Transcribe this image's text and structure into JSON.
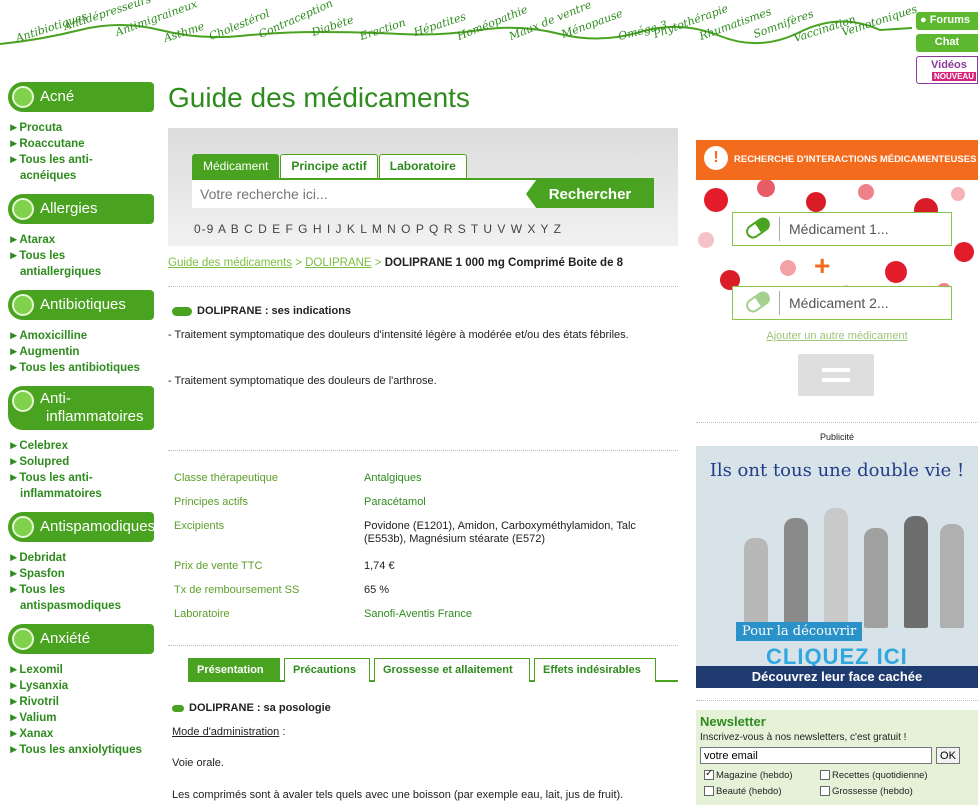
{
  "topnav": {
    "links": [
      "Antibiotiques",
      "Antidépresseurs",
      "Antimigraineux",
      "Asthme",
      "Cholestérol",
      "Contraception",
      "Diabète",
      "Erection",
      "Hépatites",
      "Homéopathie",
      "Maux de ventre",
      "Ménopause",
      "Oméga 3",
      "Phytothérapie",
      "Rhumatismes",
      "Somnifères",
      "Vaccination",
      "Veinotoniques"
    ],
    "forums": "Forums",
    "chat": "Chat",
    "videos": "Vidéos",
    "videos_badge": "NOUVEAU"
  },
  "sidebar": {
    "sections": [
      {
        "title": "Acné",
        "links": [
          "►Procuta",
          "►Roaccutane",
          "►Tous les anti-",
          "acnéiques"
        ]
      },
      {
        "title": "Allergies",
        "links": [
          "►Atarax",
          "►Tous les",
          "antiallergiques"
        ]
      },
      {
        "title": "Antibiotiques",
        "links": [
          "►Amoxicilline",
          "►Augmentin",
          "►Tous les antibiotiques"
        ]
      },
      {
        "title": "Anti-",
        "title2": "inflammatoires",
        "links": [
          "►Celebrex",
          "►Solupred",
          "►Tous les anti-",
          "inflammatoires"
        ]
      },
      {
        "title": "Antispamodiques",
        "links": [
          "►Debridat",
          "►Spasfon",
          "►Tous les",
          "antispasmodiques"
        ]
      },
      {
        "title": "Anxiété",
        "links": [
          "►Lexomil",
          "►Lysanxia",
          "►Rivotril",
          "►Valium",
          "►Xanax",
          "►Tous les anxiolytiques"
        ]
      }
    ]
  },
  "main": {
    "title": "Guide des médicaments",
    "search": {
      "tabs": [
        "Médicament",
        "Principe actif",
        "Laboratoire"
      ],
      "placeholder": "Votre recherche ici...",
      "button": "Rechercher",
      "alphabet": [
        "0-9",
        "A",
        "B",
        "C",
        "D",
        "E",
        "F",
        "G",
        "H",
        "I",
        "J",
        "K",
        "L",
        "M",
        "N",
        "O",
        "P",
        "Q",
        "R",
        "S",
        "T",
        "U",
        "V",
        "W",
        "X",
        "Y",
        "Z"
      ]
    },
    "breadcrumb": {
      "home": "Guide des médicaments",
      "sep": " > ",
      "drug": "DOLIPRANE",
      "current": "DOLIPRANE 1 000 mg Comprimé Boite de 8"
    },
    "indications": {
      "title": "DOLIPRANE : ses indications",
      "p1": "- Traitement symptomatique des douleurs d'intensité légère à modérée et/ou des états fébriles.",
      "p2": "- Traitement symptomatique des douleurs de l'arthrose."
    },
    "info": [
      {
        "label": "Classe thérapeutique",
        "value": "Antalgiques",
        "link": true
      },
      {
        "label": "Principes actifs",
        "value": "Paracétamol",
        "link": true
      },
      {
        "label": "Excipients",
        "value": "Povidone (E1201), Amidon, Carboxyméthylamidon, Talc (E553b), Magnésium stéarate (E572)",
        "link": false
      },
      {
        "label": "Prix de vente TTC",
        "value": "1,74 €",
        "link": false
      },
      {
        "label": "Tx de remboursement SS",
        "value": "65 %",
        "link": false
      },
      {
        "label": "Laboratoire",
        "value": "Sanofi-Aventis France",
        "link": true
      }
    ],
    "lower_tabs": [
      "Présentation",
      "Précautions",
      "Grossesse et allaitement",
      "Effets indésirables"
    ],
    "posologie": {
      "title": "DOLIPRANE : sa posologie",
      "mode_label": "Mode d'administration",
      "mode_suffix": " :",
      "voie": "Voie orale.",
      "p1": "Les comprimés sont à avaler tels quels avec une boisson (par exemple eau, lait, jus de fruit)."
    }
  },
  "interactions": {
    "header": "RECHERCHE D'INTERACTIONS MÉDICAMENTEUSES",
    "med1": "Médicament 1...",
    "med2": "Médicament 2...",
    "plus": "+",
    "add": "Ajouter un autre médicament"
  },
  "ad": {
    "label": "Publicité",
    "headline": "Ils ont tous une double vie !",
    "cta1": "Pour la découvrir",
    "cta2": "CLIQUEZ ICI",
    "footer": "Découvrez leur face cachée"
  },
  "newsletter": {
    "title": "Newsletter",
    "subtitle": "Inscrivez-vous à nos newsletters, c'est gratuit !",
    "email_value": "votre email",
    "ok": "OK",
    "options": [
      {
        "label": "Magazine (hebdo)",
        "checked": true
      },
      {
        "label": "Recettes (quotidienne)",
        "checked": false
      },
      {
        "label": "Beauté (hebdo)",
        "checked": false
      },
      {
        "label": "Grossesse (hebdo)",
        "checked": false
      }
    ]
  },
  "colors": {
    "green": "#4aa320",
    "darkgreen": "#2e8b1e",
    "orange": "#f36b1c"
  }
}
